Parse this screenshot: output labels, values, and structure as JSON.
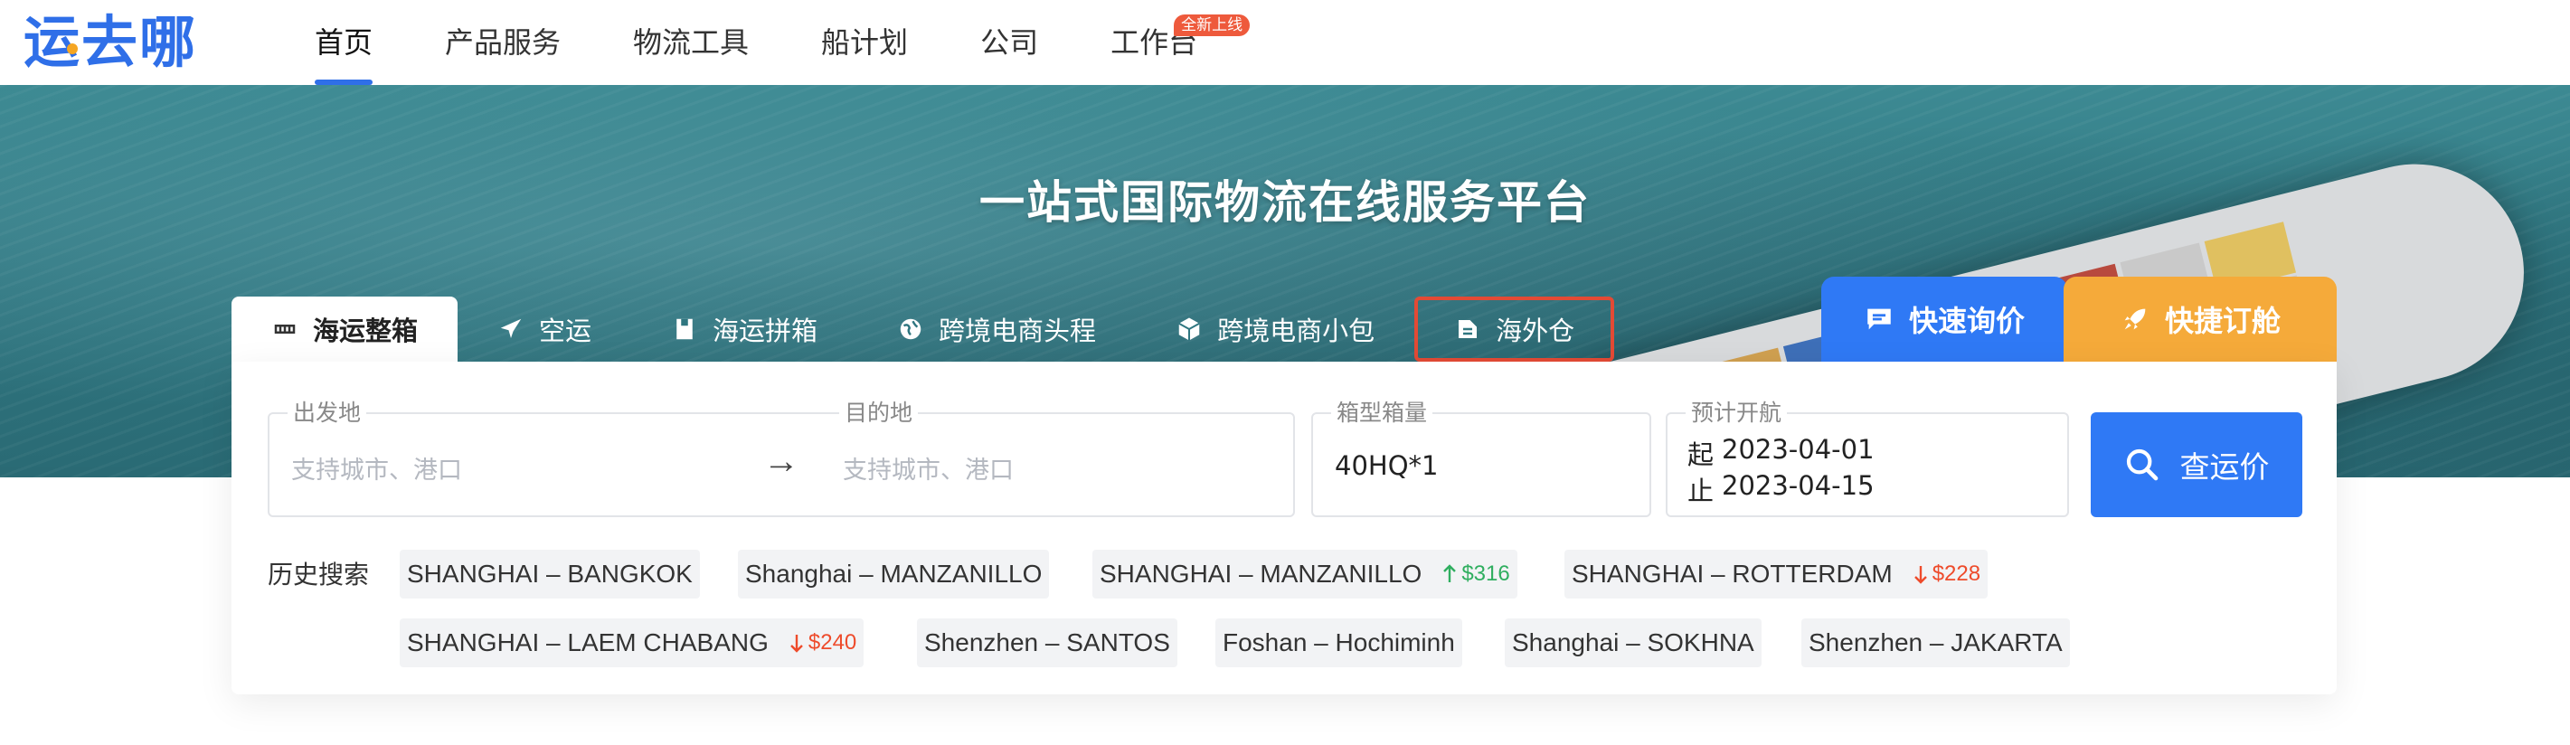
{
  "header": {
    "logo": "运去哪",
    "nav": [
      {
        "label": "首页",
        "active": true
      },
      {
        "label": "产品服务"
      },
      {
        "label": "物流工具"
      },
      {
        "label": "船计划"
      },
      {
        "label": "公司"
      },
      {
        "label": "工作台",
        "badge": "全新上线"
      }
    ]
  },
  "hero": {
    "title": "一站式国际物流在线服务平台"
  },
  "tabs": [
    {
      "label": "海运整箱",
      "icon": "container-icon",
      "active": true
    },
    {
      "label": "空运",
      "icon": "airplane-icon"
    },
    {
      "label": "海运拼箱",
      "icon": "box-icon"
    },
    {
      "label": "跨境电商头程",
      "icon": "globe-icon"
    },
    {
      "label": "跨境电商小包",
      "icon": "package-icon"
    },
    {
      "label": "海外仓",
      "icon": "warehouse-icon",
      "highlighted": true
    }
  ],
  "quick_actions": {
    "inquiry": "快速询价",
    "booking": "快捷订舱"
  },
  "search": {
    "origin_label": "出发地",
    "origin_placeholder": "支持城市、港口",
    "destination_label": "目的地",
    "destination_placeholder": "支持城市、港口",
    "arrow": "→",
    "container_label": "箱型箱量",
    "container_value": "40HQ*1",
    "sailing_label": "预计开航",
    "start_prefix": "起",
    "start_date": "2023-04-01",
    "end_prefix": "止",
    "end_date": "2023-04-15",
    "button": "查运价"
  },
  "history": {
    "label": "历史搜索",
    "items": [
      {
        "route": "SHANGHAI – BANGKOK"
      },
      {
        "route": "Shanghai – MANZANILLO"
      },
      {
        "route": "SHANGHAI – MANZANILLO",
        "trend": "up",
        "delta": "$316"
      },
      {
        "route": "SHANGHAI – ROTTERDAM",
        "trend": "down",
        "delta": "$228"
      },
      {
        "route": "SHANGHAI – LAEM CHABANG",
        "trend": "down",
        "delta": "$240"
      },
      {
        "route": "Shenzhen – SANTOS"
      },
      {
        "route": "Foshan – Hochiminh"
      },
      {
        "route": "Shanghai – SOKHNA"
      },
      {
        "route": "Shenzhen – JAKARTA"
      }
    ]
  },
  "colors": {
    "brand_blue": "#2f79f5",
    "booking_orange": "#f5aa3a",
    "trend_up": "#2fae5f",
    "trend_down": "#ee4b2b",
    "highlight_red": "#e34a35"
  }
}
